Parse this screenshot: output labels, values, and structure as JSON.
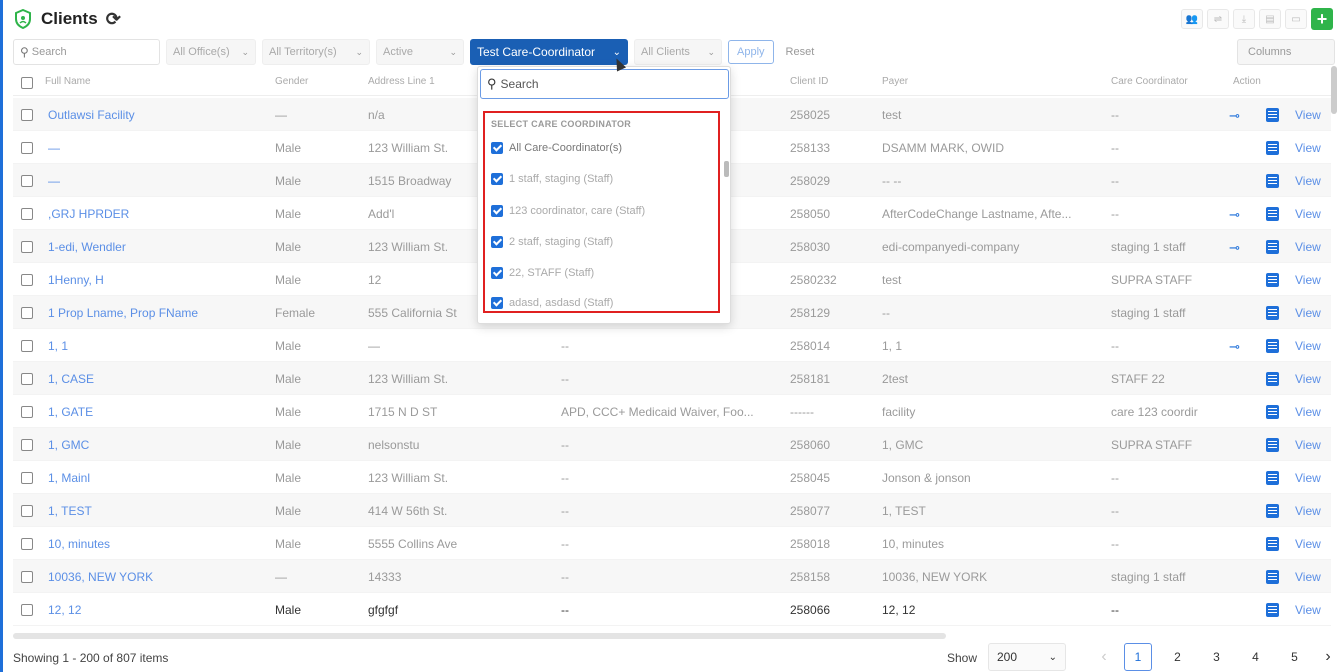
{
  "header": {
    "title": "Clients",
    "shield_icon": "shield-icon",
    "refresh_icon": "refresh-icon",
    "add_button": "+"
  },
  "filters": {
    "search_placeholder": "Search",
    "offices": "All Office(s)",
    "territory": "All Territory(s)",
    "status": "Active",
    "care_coordinator": "Test Care-Coordinator",
    "clients": "All Clients",
    "apply": "Apply",
    "reset": "Reset",
    "columns": "Columns"
  },
  "columns": [
    "Full Name",
    "Gender",
    "Address Line 1",
    "Client ID",
    "Payer",
    "Care Coordinator",
    "Action"
  ],
  "dropdown": {
    "search_placeholder": "Search",
    "header": "SELECT CARE COORDINATOR",
    "items": [
      "All Care-Coordinator(s)",
      "1 staff, staging (Staff)",
      "123 coordinator, care (Staff)",
      "2 staff, staging (Staff)",
      "22, STAFF (Staff)",
      "adasd, asdasd (Staff)"
    ]
  },
  "rows": [
    {
      "name": "Outlawsi Facility",
      "gender": "—",
      "address": "n/a",
      "program": "",
      "client_id": "258025",
      "payer": "test",
      "coordinator": "--",
      "key": true
    },
    {
      "name": "—",
      "gender": "Male",
      "address": "123 William St.",
      "program": "",
      "client_id": "258133",
      "payer": "DSAMM MARK, OWID",
      "coordinator": "--",
      "key": false
    },
    {
      "name": "—",
      "gender": "Male",
      "address": "1515 Broadway",
      "program": "",
      "client_id": "258029",
      "payer": "-- --",
      "coordinator": "--",
      "key": false
    },
    {
      "name": ",GRJ HPRDER",
      "gender": "Male",
      "address": "Add'l",
      "program": "",
      "client_id": "258050",
      "payer": "AfterCodeChange Lastname, Afte...",
      "coordinator": "--",
      "key": true
    },
    {
      "name": "1-edi, Wendler",
      "gender": "Male",
      "address": "123 William St.",
      "program": "",
      "client_id": "258030",
      "payer": "edi-companyedi-company",
      "coordinator": "staging 1 staff",
      "key": true
    },
    {
      "name": "1Henny, H",
      "gender": "Male",
      "address": "12",
      "program": "",
      "client_id": "2580232",
      "payer": "test",
      "coordinator": "SUPRA STAFF",
      "key": false
    },
    {
      "name": "1 Prop Lname, Prop FName",
      "gender": "Female",
      "address": "555 California St",
      "program": "",
      "client_id": "258129",
      "payer": "--",
      "coordinator": "staging 1 staff",
      "key": false
    },
    {
      "name": "1, 1",
      "gender": "Male",
      "address": "—",
      "program": "--",
      "client_id": "258014",
      "payer": "1, 1",
      "coordinator": "--",
      "key": true
    },
    {
      "name": "1, CASE",
      "gender": "Male",
      "address": "123 William St.",
      "program": "--",
      "client_id": "258181",
      "payer": "2test",
      "coordinator": "STAFF 22",
      "key": false
    },
    {
      "name": "1, GATE",
      "gender": "Male",
      "address": "1715 N D ST",
      "program": "APD, CCC+ Medicaid Waiver, Foo...",
      "client_id": "------",
      "payer": "facility",
      "coordinator": "care 123 coordir",
      "key": false
    },
    {
      "name": "1, GMC",
      "gender": "Male",
      "address": "nelsonstu",
      "program": "--",
      "client_id": "258060",
      "payer": "1, GMC",
      "coordinator": "SUPRA STAFF",
      "key": false
    },
    {
      "name": "1, Mainl",
      "gender": "Male",
      "address": "123 William St.",
      "program": "--",
      "client_id": "258045",
      "payer": "Jonson & jonson",
      "coordinator": "--",
      "key": false
    },
    {
      "name": "1, TEST",
      "gender": "Male",
      "address": "414 W 56th St.",
      "program": "--",
      "client_id": "258077",
      "payer": "1, TEST",
      "coordinator": "--",
      "key": false
    },
    {
      "name": "10, minutes",
      "gender": "Male",
      "address": "5555 Collins Ave",
      "program": "--",
      "client_id": "258018",
      "payer": "10, minutes",
      "coordinator": "--",
      "key": false
    },
    {
      "name": "10036, NEW YORK",
      "gender": "—",
      "address": "14333",
      "program": "--",
      "client_id": "258158",
      "payer": "10036, NEW YORK",
      "coordinator": "staging 1 staff",
      "key": false
    },
    {
      "name": "12, 12",
      "gender": "Male",
      "address": "gfgfgf",
      "program": "--",
      "client_id": "258066",
      "payer": "12, 12",
      "coordinator": "--",
      "key": false
    }
  ],
  "view_label": "View",
  "footer": {
    "showing": "Showing 1 - 200 of 807 items",
    "show_label": "Show",
    "page_size": "200",
    "pages": [
      "1",
      "2",
      "3",
      "4",
      "5"
    ],
    "current_page": "1"
  }
}
